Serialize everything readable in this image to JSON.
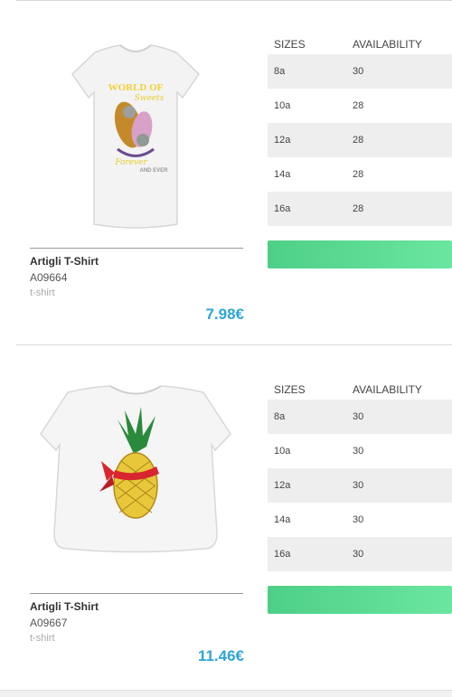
{
  "table_headers": {
    "sizes": "SIZES",
    "availability": "AVAILABILITY"
  },
  "products": [
    {
      "name": "Artigli T-Shirt",
      "code": "A09664",
      "category": "t-shirt",
      "price": "7.98€",
      "image_text": "WORLD OF",
      "image_text_2": "AND EVER",
      "rows": [
        {
          "size": "8a",
          "qty": "30"
        },
        {
          "size": "10a",
          "qty": "28"
        },
        {
          "size": "12a",
          "qty": "28"
        },
        {
          "size": "14a",
          "qty": "28"
        },
        {
          "size": "16a",
          "qty": "28"
        }
      ]
    },
    {
      "name": "Artigli T-Shirt",
      "code": "A09667",
      "category": "t-shirt",
      "price": "11.46€",
      "rows": [
        {
          "size": "8a",
          "qty": "30"
        },
        {
          "size": "10a",
          "qty": "30"
        },
        {
          "size": "12a",
          "qty": "30"
        },
        {
          "size": "14a",
          "qty": "30"
        },
        {
          "size": "16a",
          "qty": "30"
        }
      ]
    }
  ]
}
